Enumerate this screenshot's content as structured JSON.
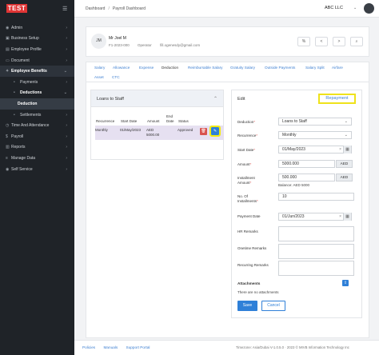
{
  "app": {
    "logo": "TEST",
    "menu_icon": "hamburger-icon"
  },
  "sidebar": {
    "items": [
      {
        "label": "Admin",
        "icon": "user-icon"
      },
      {
        "label": "Business Setup",
        "icon": "briefcase-icon"
      },
      {
        "label": "Employee Profile",
        "icon": "id-card-icon"
      },
      {
        "label": "Document",
        "icon": "document-icon"
      },
      {
        "label": "Employee Benefits",
        "icon": "gift-icon"
      },
      {
        "label": "Payments"
      },
      {
        "label": "Deductions"
      },
      {
        "label": "Deduction"
      },
      {
        "label": "Settlements"
      },
      {
        "label": "Time And Attendance",
        "icon": "clock-icon"
      },
      {
        "label": "Payroll",
        "icon": "money-icon"
      },
      {
        "label": "Reports",
        "icon": "report-icon"
      },
      {
        "label": "Manage Data",
        "icon": "database-icon"
      },
      {
        "label": "Self Service",
        "icon": "person-icon"
      }
    ]
  },
  "topbar": {
    "breadcrumb": [
      "Dashboard",
      "Payroll Dashboard"
    ],
    "company": "ABC LLC"
  },
  "employee": {
    "initials": "JM",
    "name": "Mr Joel M",
    "code": "F1-2023-000",
    "role": "Operator",
    "email": "fill.ogenesdy@gmail.com",
    "buttons": [
      "%",
      "<",
      ">",
      "⌕"
    ]
  },
  "tabs": [
    "Salary",
    "Allowance",
    "Expense",
    "Deduction",
    "Reimbursable Salary",
    "Gratuity Salary",
    "Outside Payments",
    "Salary Split",
    "Airfare",
    "Asset",
    "CTC"
  ],
  "loans": {
    "title": "Loans to Staff",
    "columns": [
      "Recurrence",
      "Start Date",
      "Amount",
      "End Date",
      "Status"
    ],
    "rows": [
      {
        "recurrence": "Monthly",
        "start_date": "01/May/2023",
        "amount": "AED 5000.00",
        "end_date": "",
        "status": "Approved"
      }
    ]
  },
  "edit": {
    "title": "Edit",
    "repayment_label": "Repayment",
    "deduction_label": "Deduction",
    "deduction_value": "Loans to Staff",
    "recurrence_label": "Recurrence",
    "recurrence_value": "Monthly",
    "start_date_label": "Start Date",
    "start_date_value": "01/May/2023",
    "amount_label": "Amount",
    "amount_value": "5000.000",
    "amount_unit": "AED",
    "installment_amount_label_1": "Installment",
    "installment_amount_label_2": "Amount",
    "installment_amount_value": "500.000",
    "installment_unit": "AED",
    "balance_text": "Balance: AED 5000",
    "installments_label_1": "No. Of",
    "installments_label_2": "Installments",
    "installments_value": "10",
    "payment_date_label": "Payment Date",
    "payment_date_value": "01/Jun/2023",
    "hr_remarks_label": "HR Remarks",
    "onetime_remarks_label": "Onetime Remarks",
    "recurring_remarks_label": "Recurring Remarks",
    "attachments_label": "Attachments",
    "no_attachments": "There are no attachments",
    "save_label": "Save",
    "cancel_label": "Cancel"
  },
  "footer": {
    "links": [
      "Policies",
      "Manuals",
      "Support Portal"
    ],
    "right": "Timezone: Asia/Dubai   V-1.0.5.0 · 2023 ©   MIVB Information Technology Inc"
  },
  "colors": {
    "accent": "#2f80d8",
    "highlight": "#efe21b",
    "danger": "#d9534f",
    "sidebar": "#1f2328"
  }
}
